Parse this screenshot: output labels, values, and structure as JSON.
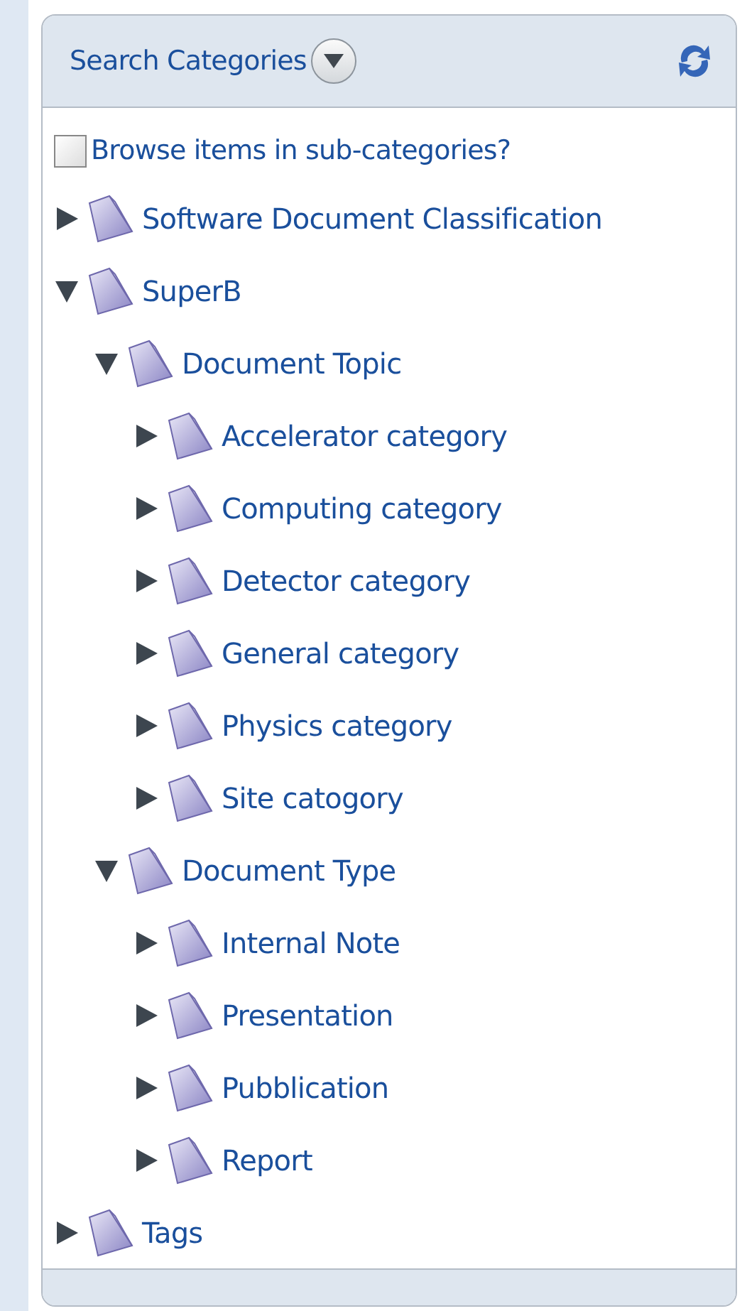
{
  "panel": {
    "title": "Search Categories"
  },
  "browse_option": {
    "label": "Browse items in sub-categories?",
    "checked": false
  },
  "tree": [
    {
      "label": "Software Document Classification",
      "expanded": false
    },
    {
      "label": "SuperB",
      "expanded": true,
      "children": [
        {
          "label": "Document Topic",
          "expanded": true,
          "children": [
            {
              "label": "Accelerator category",
              "expanded": false
            },
            {
              "label": "Computing category",
              "expanded": false
            },
            {
              "label": "Detector category",
              "expanded": false
            },
            {
              "label": "General category",
              "expanded": false
            },
            {
              "label": "Physics category",
              "expanded": false
            },
            {
              "label": "Site catogory",
              "expanded": false
            }
          ]
        },
        {
          "label": "Document Type",
          "expanded": true,
          "children": [
            {
              "label": "Internal Note",
              "expanded": false
            },
            {
              "label": "Presentation",
              "expanded": false
            },
            {
              "label": "Pubblication",
              "expanded": false
            },
            {
              "label": "Report",
              "expanded": false
            }
          ]
        }
      ]
    },
    {
      "label": "Tags",
      "expanded": false
    }
  ]
}
